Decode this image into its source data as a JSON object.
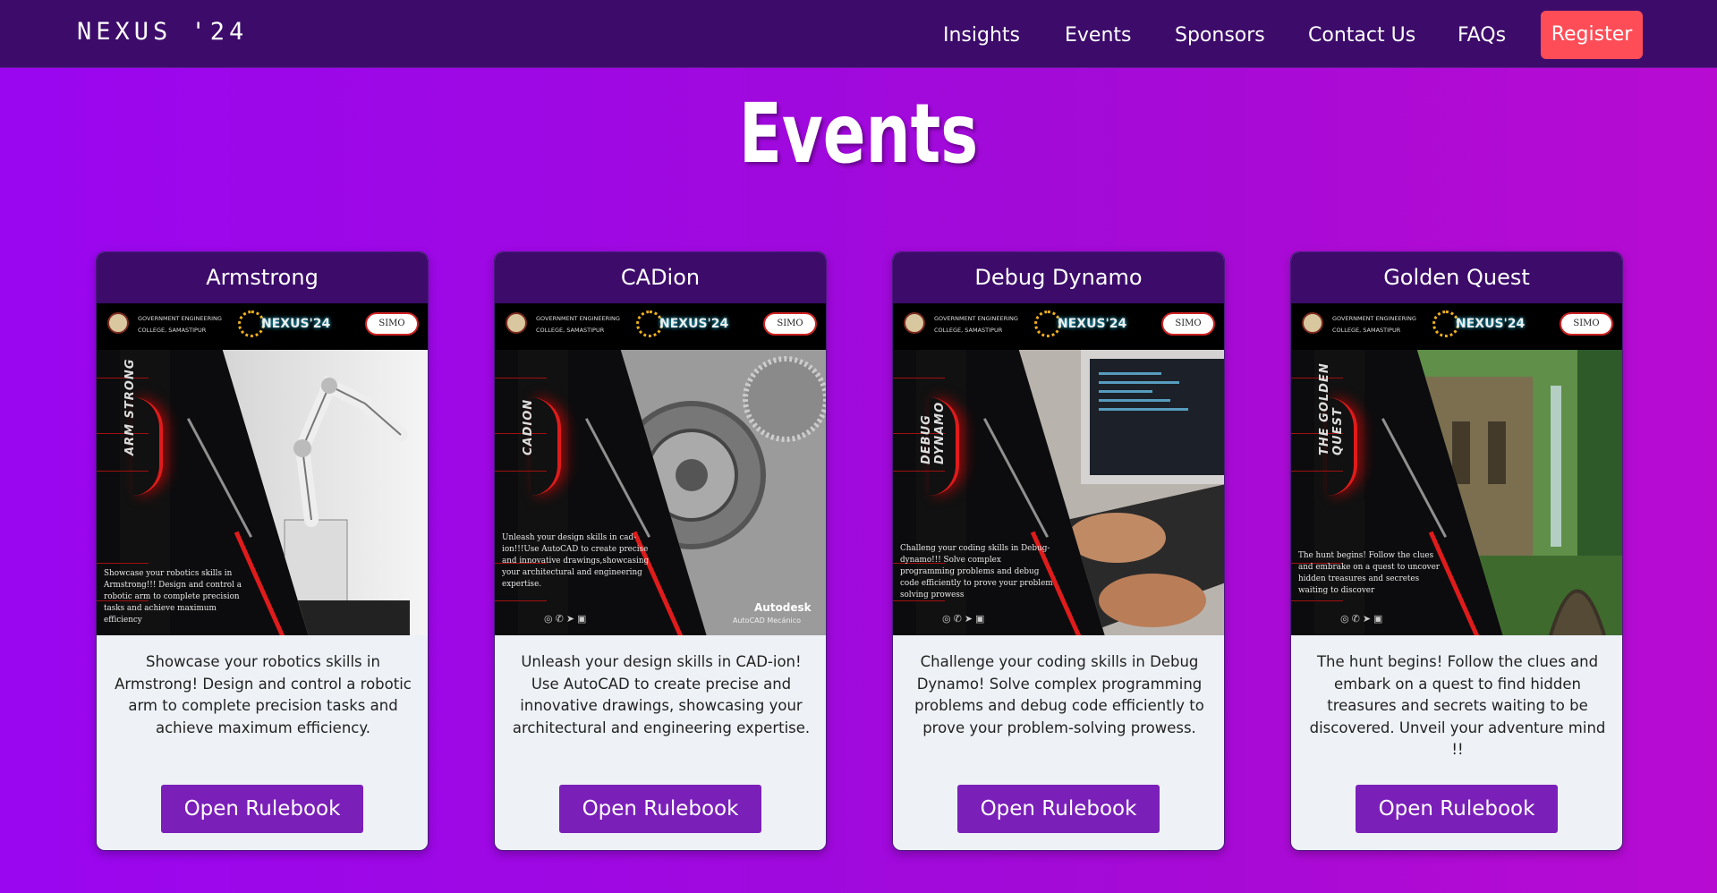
{
  "navbar": {
    "brand": "NEXUS '24",
    "items": [
      "Insights",
      "Events",
      "Sponsors",
      "Contact Us",
      "FAQs"
    ],
    "register": "Register"
  },
  "page": {
    "heading": "Events"
  },
  "colors": {
    "nav_bg": "#3d0c6b",
    "accent": "#7b1fb9",
    "register": "#ff4d57"
  },
  "poster_common": {
    "college": "GOVERNMENT ENGINEERING COLLEGE, SAMASTIPUR",
    "logo": "NEXUS'24",
    "sponsor": "SIMO"
  },
  "cards": [
    {
      "title": "Armstrong",
      "poster_label": "ARM STRONG",
      "poster_text": "Showcase your robotics skills in Armstrong!!! Design and control a robotic arm to complete precision tasks and achieve maximum efficiency",
      "description": "Showcase your robotics skills in Armstrong! Design and control a robotic arm to complete precision tasks and achieve maximum efficiency.",
      "button": "Open Rulebook"
    },
    {
      "title": "CADion",
      "poster_label": "CADION",
      "poster_text": "Unleash your design skills in cad-ion!!!Use AutoCAD to create precise and innovative drawings,showcasing your architectural and engineering expertise.",
      "poster_brand": "Autodesk",
      "poster_brand_sub": "AutoCAD Mecánico",
      "description": "Unleash your design skills in CAD-ion! Use AutoCAD to create precise and innovative drawings, showcasing your architectural and engineering expertise.",
      "button": "Open Rulebook"
    },
    {
      "title": "Debug Dynamo",
      "poster_label": "DEBUG DYNAMO",
      "poster_text": "Challeng your coding skills in Debug-dynamo!!! Solve complex programming problems and debug code efficiently to prove your problem solving prowess",
      "description": "Challenge your coding skills in Debug Dynamo! Solve complex programming problems and debug code efficiently to prove your problem-solving prowess.",
      "button": "Open Rulebook"
    },
    {
      "title": "Golden Quest",
      "poster_label": "THE GOLDEN QUEST",
      "poster_text": "The hunt begins! Follow the clues and embrake on a quest to uncover hidden treasures and secretes waiting to discover",
      "description": "The hunt begins! Follow the clues and embark on a quest to find hidden treasures and secrets waiting to be discovered. Unveil your adventure mind !!",
      "button": "Open Rulebook"
    }
  ]
}
